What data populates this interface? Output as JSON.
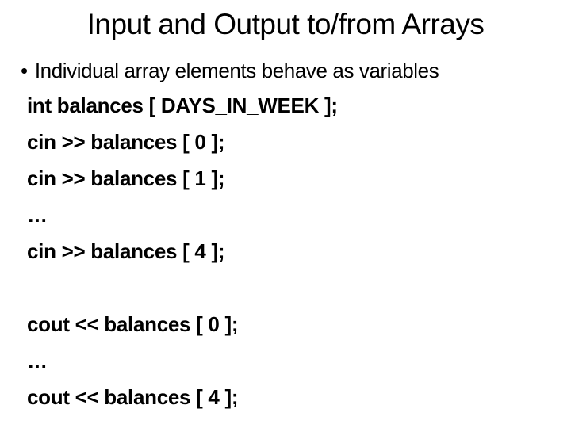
{
  "slide": {
    "title": "Input and Output to/from Arrays",
    "bullet": "Individual array elements behave as variables",
    "code_lines": [
      "int balances [ DAYS_IN_WEEK ];",
      "cin >> balances [ 0 ];",
      "cin >> balances [ 1 ];",
      "…",
      "cin >> balances [ 4 ];",
      "",
      "cout << balances [ 0 ];",
      "…",
      "cout << balances [ 4 ];"
    ]
  }
}
